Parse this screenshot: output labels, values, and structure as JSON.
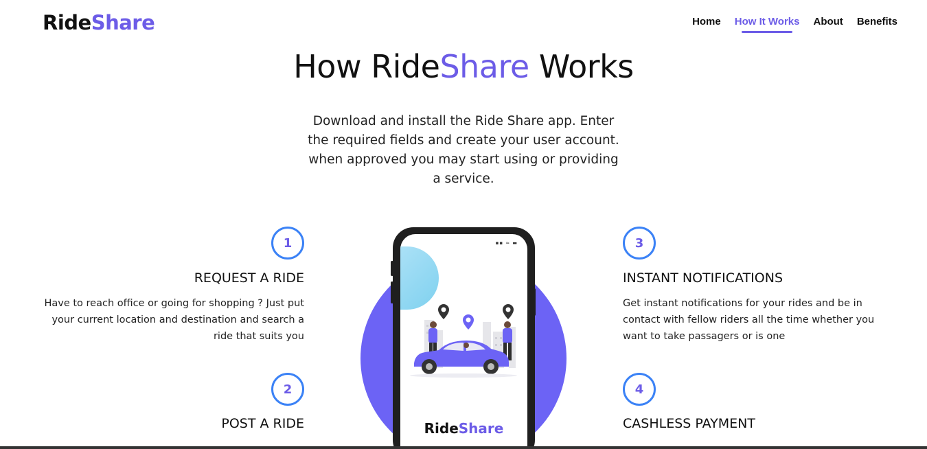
{
  "nav": {
    "logo_part1": "Ride",
    "logo_part2": "Share",
    "links": [
      "Home",
      "How It Works",
      "About",
      "Benefits"
    ],
    "active_link": "How It Works",
    "accent_color": "#6c5ce7"
  },
  "hero": {
    "title_part1": "How Ride",
    "title_part2": "Share",
    "title_part3": " Works",
    "description": "Download and install the Ride Share app. Enter the required fields and create your user account. when approved you may start using or providing a service."
  },
  "steps": [
    {
      "number": "1",
      "title": "REQUEST A RIDE",
      "text": "Have to reach office or going for shopping ? Just put your current location and destination and search a ride that suits you"
    },
    {
      "number": "2",
      "title": "POST A RIDE",
      "text": ""
    },
    {
      "number": "3",
      "title": "INSTANT NOTIFICATIONS",
      "text": "Get instant notifications for your rides and be in contact with fellow riders all the time whether you want to take passagers or is one"
    },
    {
      "number": "4",
      "title": "CASHLESS PAYMENT",
      "text": ""
    }
  ],
  "phone": {
    "logo_part1": "Ride",
    "logo_part2": "Share",
    "status_icons": "▪▪ ≈ ▬",
    "illustration_icon": "car-ride-illustration-icon"
  }
}
